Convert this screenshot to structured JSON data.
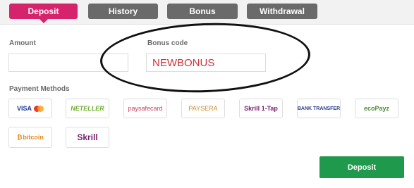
{
  "tabs": [
    {
      "label": "Deposit",
      "active": true
    },
    {
      "label": "History",
      "active": false
    },
    {
      "label": "Bonus",
      "active": false
    },
    {
      "label": "Withdrawal",
      "active": false
    }
  ],
  "form": {
    "amount_label": "Amount",
    "amount_value": "",
    "bonus_code_label": "Bonus code",
    "bonus_code_value": "NEWBONUS"
  },
  "payment_methods_label": "Payment Methods",
  "payment_methods": [
    {
      "name": "VISA",
      "color": "#1a3a8f"
    },
    {
      "name": "NETELLER",
      "color": "#6cab2e"
    },
    {
      "name": "paysafecard",
      "color": "#c94060"
    },
    {
      "name": "PAYSERA",
      "color": "#cf8a2b"
    },
    {
      "name": "Skrill 1-Tap",
      "color": "#7b1f6e"
    },
    {
      "name": "BANK TRANSFER",
      "color": "#2d3f8f"
    },
    {
      "name": "ecoPayz",
      "color": "#4e8a3a"
    },
    {
      "name": "bitcoin",
      "color": "#e58a1c"
    },
    {
      "name": "Skrill",
      "color": "#7b1f6e"
    }
  ],
  "deposit_button_label": "Deposit",
  "colors": {
    "accent": "#d6246c",
    "tab_inactive": "#6a6a6a",
    "deposit_button": "#1f9a4c",
    "bonus_text": "#d0343a"
  }
}
